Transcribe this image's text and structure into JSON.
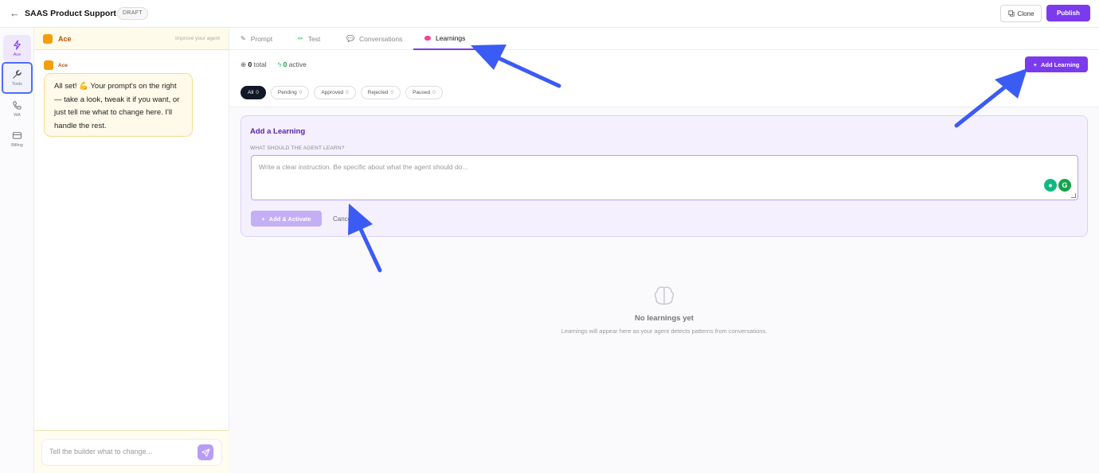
{
  "header": {
    "back_icon": "arrow-left-icon",
    "title": "SAAS Product Support",
    "status": "DRAFT",
    "clone_label": "Clone",
    "publish_label": "Publish"
  },
  "rail": {
    "items": [
      {
        "label": "Ace",
        "icon": "lightning-icon"
      },
      {
        "label": "Tools",
        "icon": "wrench-icon"
      },
      {
        "label": "WA",
        "icon": "phone-icon"
      },
      {
        "label": "Billing",
        "icon": "card-icon"
      }
    ]
  },
  "chat": {
    "header_name": "Ace",
    "improve_label": "Improve your agent",
    "message_author": "Ace",
    "message_text": "All set! 💪 Your prompt's on the right — take a look, tweak it if you want, or just tell me what to change here. I'll handle the rest.",
    "input_placeholder": "Tell the builder what to change..."
  },
  "tabs": [
    {
      "label": "Prompt"
    },
    {
      "label": "Test"
    },
    {
      "label": "Conversations"
    },
    {
      "label": "Learnings"
    }
  ],
  "stats": {
    "total_count": "0",
    "total_label": "total",
    "active_count": "0",
    "active_label": "active"
  },
  "add_learning_label": "Add Learning",
  "filters": [
    {
      "label": "All",
      "count": "0"
    },
    {
      "label": "Pending",
      "count": "0"
    },
    {
      "label": "Approved",
      "count": "0"
    },
    {
      "label": "Rejected",
      "count": "0"
    },
    {
      "label": "Paused",
      "count": "0"
    }
  ],
  "form": {
    "title": "Add a Learning",
    "field_label": "WHAT SHOULD THE AGENT LEARN?",
    "placeholder": "Write a clear instruction. Be specific about what the agent should do...",
    "submit_label": "Add & Activate",
    "cancel_label": "Cancel"
  },
  "empty": {
    "title": "No learnings yet",
    "subtitle": "Learnings will appear here as your agent detects patterns from conversations."
  },
  "colors": {
    "accent": "#7c3aed",
    "annotation_arrow": "#3b5bf5",
    "chat_bg": "#fffaea"
  }
}
